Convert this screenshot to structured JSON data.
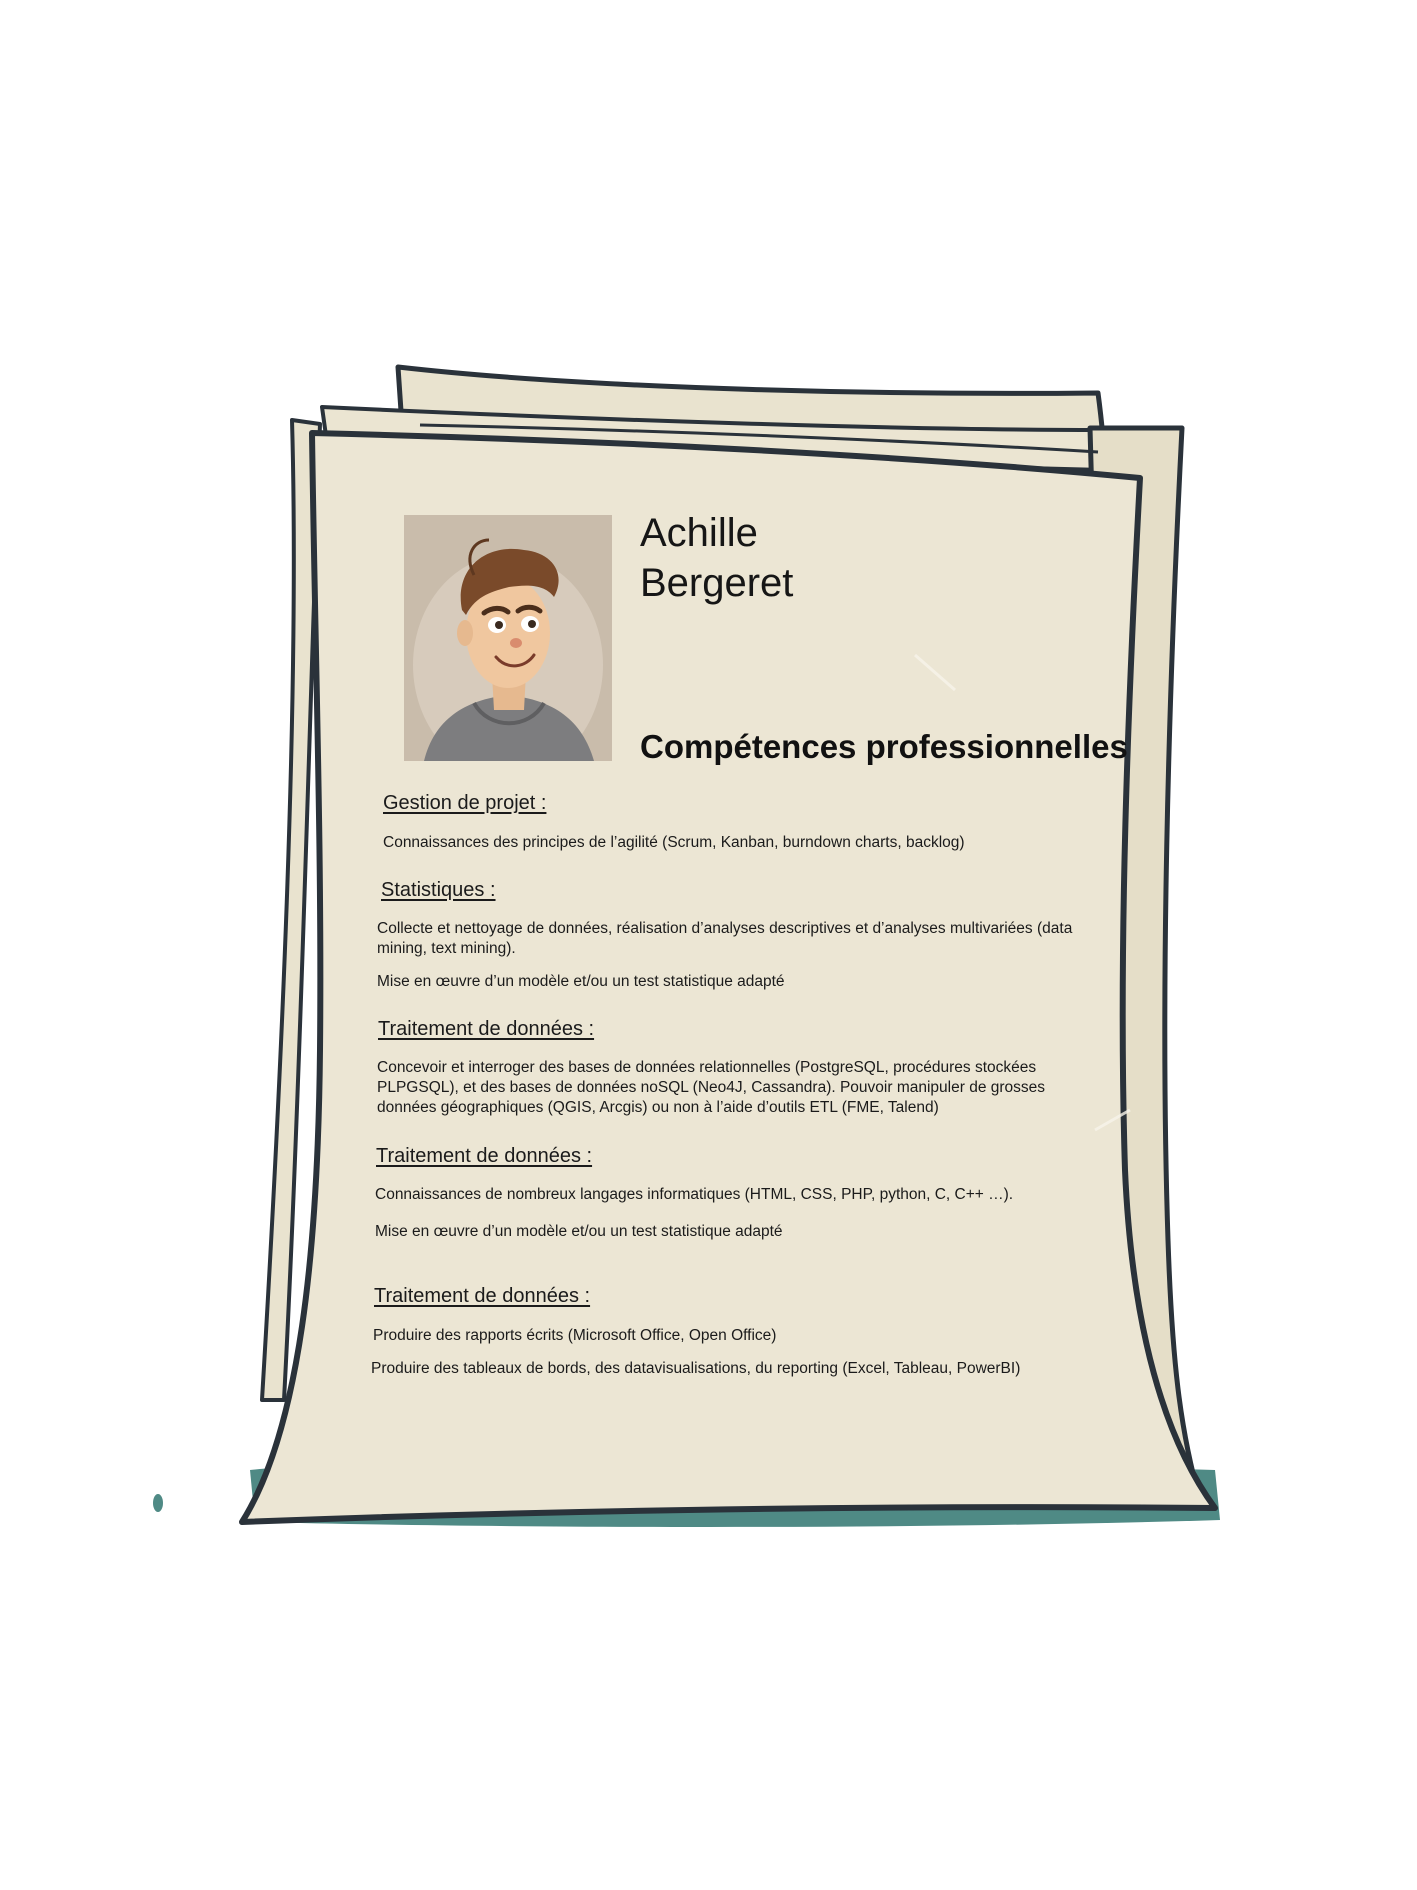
{
  "profile": {
    "first_name": "Achille",
    "last_name": "Bergeret",
    "portrait_icon": "cartoon-portrait-young-man-hoodie"
  },
  "main_title": "Compétences professionnelles",
  "sections": [
    {
      "heading": "Gestion de projet :",
      "paragraphs": [
        "Connaissances des principes de l’agilité (Scrum, Kanban, burndown charts, backlog)"
      ]
    },
    {
      "heading": "Statistiques :",
      "paragraphs": [
        "Collecte et nettoyage de données, réalisation d’analyses descriptives et d’analyses multivariées (data mining, text mining).",
        "Mise en œuvre d’un modèle et/ou un test statistique adapté"
      ]
    },
    {
      "heading": "Traitement de données :",
      "paragraphs": [
        "Concevoir et interroger des bases de données relationnelles (PostgreSQL, procédures stockées PLPGSQL), et des bases de données noSQL (Neo4J, Cassandra). Pouvoir manipuler de grosses données géographiques (QGIS, Arcgis) ou non à l’aide d’outils ETL (FME, Talend)"
      ]
    },
    {
      "heading": "Traitement de données :",
      "paragraphs": [
        "Connaissances de nombreux langages informatiques (HTML, CSS, PHP, python, C, C++ …).",
        "Mise en œuvre d’un modèle et/ou un test statistique adapté"
      ]
    },
    {
      "heading": "Traitement de données :",
      "paragraphs": [
        "Produire des rapports écrits (Microsoft Office, Open Office)",
        "Produire des tableaux de bords, des datavisualisations, du reporting (Excel, Tableau, PowerBI)"
      ]
    }
  ],
  "colors": {
    "paper": "#ece6d4",
    "paper_back": "#e7e0cb",
    "outline": "#2a323a",
    "shadow": "#4f8a85",
    "text": "#1b1b1b"
  }
}
